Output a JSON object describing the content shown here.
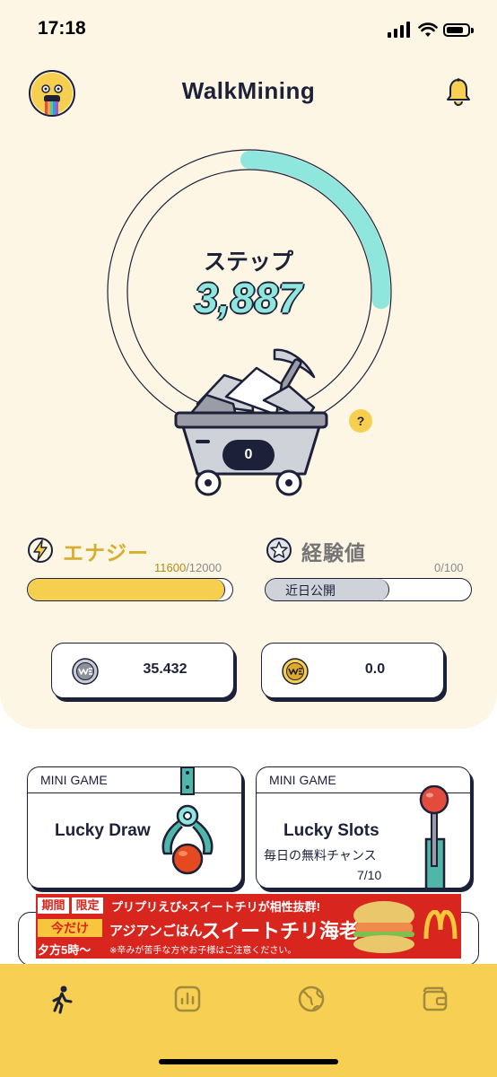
{
  "status_bar": {
    "time": "17:18"
  },
  "header": {
    "title": "WalkMining",
    "avatar_icon": "avatar-face-icon",
    "notification_icon": "bell-icon"
  },
  "steps": {
    "label": "ステップ",
    "value": "3,887",
    "progress_fraction": 0.26,
    "cart_count": "0",
    "help_label": "?"
  },
  "energy": {
    "label": "エナジー",
    "current": "11600",
    "total": "/12000",
    "fill_fraction": 0.966,
    "color": "#f7cf4e"
  },
  "experience": {
    "label": "経験値",
    "count": "0/100",
    "status": "近日公開"
  },
  "balances": [
    {
      "coin_icon": "silver-we-coin-icon",
      "value": "35.432"
    },
    {
      "coin_icon": "gold-we-coin-icon",
      "value": "0.0"
    }
  ],
  "mini_games": [
    {
      "header": "MINI GAME",
      "title": "Lucky Draw"
    },
    {
      "header": "MINI GAME",
      "title": "Lucky Slots",
      "subtitle": "毎日の無料チャンス",
      "count": "7/10"
    }
  ],
  "ad": {
    "tag1": "期間",
    "tag2": "限定",
    "line1": "プリプリえび×スイートチリが相性抜群!",
    "today": "今だけ",
    "brand": "アジアンごはん",
    "product": "スイートチリ海老",
    "time": "夕方5時～",
    "note": "※辛みが苦手な方やお子様はご注意ください。"
  },
  "bottom_nav": [
    {
      "icon": "walk-icon",
      "active": true
    },
    {
      "icon": "stats-icon",
      "active": false
    },
    {
      "icon": "globe-icon",
      "active": false
    },
    {
      "icon": "wallet-icon",
      "active": false
    }
  ],
  "colors": {
    "navy": "#1d2039",
    "cream": "#fdf6e4",
    "mint": "#8ee6dd",
    "yellow": "#f6cf53"
  }
}
